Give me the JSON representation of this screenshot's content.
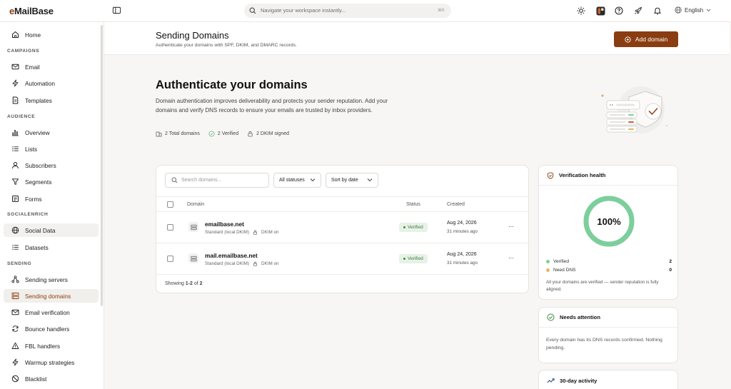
{
  "app": {
    "logo_prefix": "e",
    "logo_rest": "MailBase"
  },
  "topbar": {
    "search_placeholder": "Navigate your workspace instantly...",
    "search_shortcut": "⌘K",
    "language": "English"
  },
  "sidebar": {
    "home": "Home",
    "sections": {
      "campaigns": "CAMPAIGNS",
      "audience": "AUDIENCE",
      "socialenrich": "SOCIALENRICH",
      "sending": "SENDING"
    },
    "items": {
      "email": "Email",
      "automation": "Automation",
      "templates": "Templates",
      "overview": "Overview",
      "lists": "Lists",
      "subscribers": "Subscribers",
      "segments": "Segments",
      "forms": "Forms",
      "social_data": "Social Data",
      "datasets": "Datasets",
      "sending_servers": "Sending servers",
      "sending_domains": "Sending domains",
      "email_verification": "Email verification",
      "bounce_handlers": "Bounce handlers",
      "fbl_handlers": "FBL handlers",
      "warmup_strategies": "Warmup strategies",
      "blacklist": "Blacklist"
    }
  },
  "header": {
    "title": "Sending Domains",
    "subtitle": "Authenticate your domains with SPF, DKIM, and DMARC records.",
    "add_button": "Add domain"
  },
  "hero": {
    "title": "Authenticate your domains",
    "description": "Domain authentication improves deliverability and protects your sender reputation. Add your domains and verify DNS records to ensure your emails are trusted by inbox providers.",
    "stat_total": "2 Total domains",
    "stat_verified": "2 Verified",
    "stat_dkim": "2 DKIM signed"
  },
  "table": {
    "search_placeholder": "Search domains...",
    "status_filter": "All statuses",
    "sort": "Sort by date",
    "columns": {
      "domain": "Domain",
      "status": "Status",
      "created": "Created"
    },
    "rows": [
      {
        "domain": "emailbase.net",
        "type": "Standard (local DKIM)",
        "dkim": "DKIM on",
        "status": "Verified",
        "created": "Aug 24, 2026",
        "ago": "31 minutes ago"
      },
      {
        "domain": "mail.emailbase.net",
        "type": "Standard (local DKIM)",
        "dkim": "DKIM on",
        "status": "Verified",
        "created": "Aug 24, 2026",
        "ago": "31 minutes ago"
      }
    ],
    "footer_prefix": "Showing ",
    "footer_range": "1-2",
    "footer_mid": " of ",
    "footer_total": "2",
    "more": "···"
  },
  "health": {
    "title": "Verification health",
    "percent_label": "100%",
    "verified_fraction": 1.0,
    "legend_verified": "Verified",
    "verified_count": "2",
    "legend_need_dns": "Need DNS",
    "need_dns_count": "0",
    "note": "All your domains are verified — sender reputation is fully aligned.",
    "colors": {
      "verified": "#7ccf9c",
      "need_dns": "#e3b567"
    }
  },
  "attention": {
    "title": "Needs attention",
    "text": "Every domain has its DNS records confirmed. Nothing pending."
  },
  "activity": {
    "title": "30-day activity"
  },
  "colors": {
    "brand": "#8a3d10",
    "active_text": "#8a3d10"
  }
}
